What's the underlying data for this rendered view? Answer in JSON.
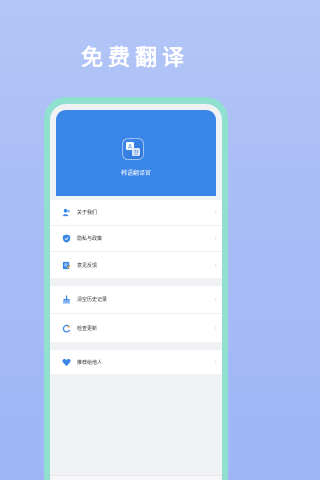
{
  "promo": {
    "title": "免费翻译"
  },
  "app": {
    "name": "韩语翻译官"
  },
  "menu": {
    "group1": [
      {
        "label": "关于我们",
        "icon": "users-icon"
      },
      {
        "label": "隐私与政策",
        "icon": "shield-icon"
      },
      {
        "label": "意见反馈",
        "icon": "feedback-icon"
      }
    ],
    "group2": [
      {
        "label": "清空历史记录",
        "icon": "broom-icon"
      },
      {
        "label": "检查更新",
        "icon": "refresh-icon"
      }
    ],
    "group3": [
      {
        "label": "推荐给他人",
        "icon": "heart-icon"
      }
    ]
  },
  "chevron": "›",
  "tabs": [
    "mic-icon",
    "book-icon",
    "card-icon",
    "profile-icon"
  ],
  "colors": {
    "accent": "#3a86e8",
    "phone_frame": "#8fe0cf",
    "background": "#a9bdf6"
  }
}
